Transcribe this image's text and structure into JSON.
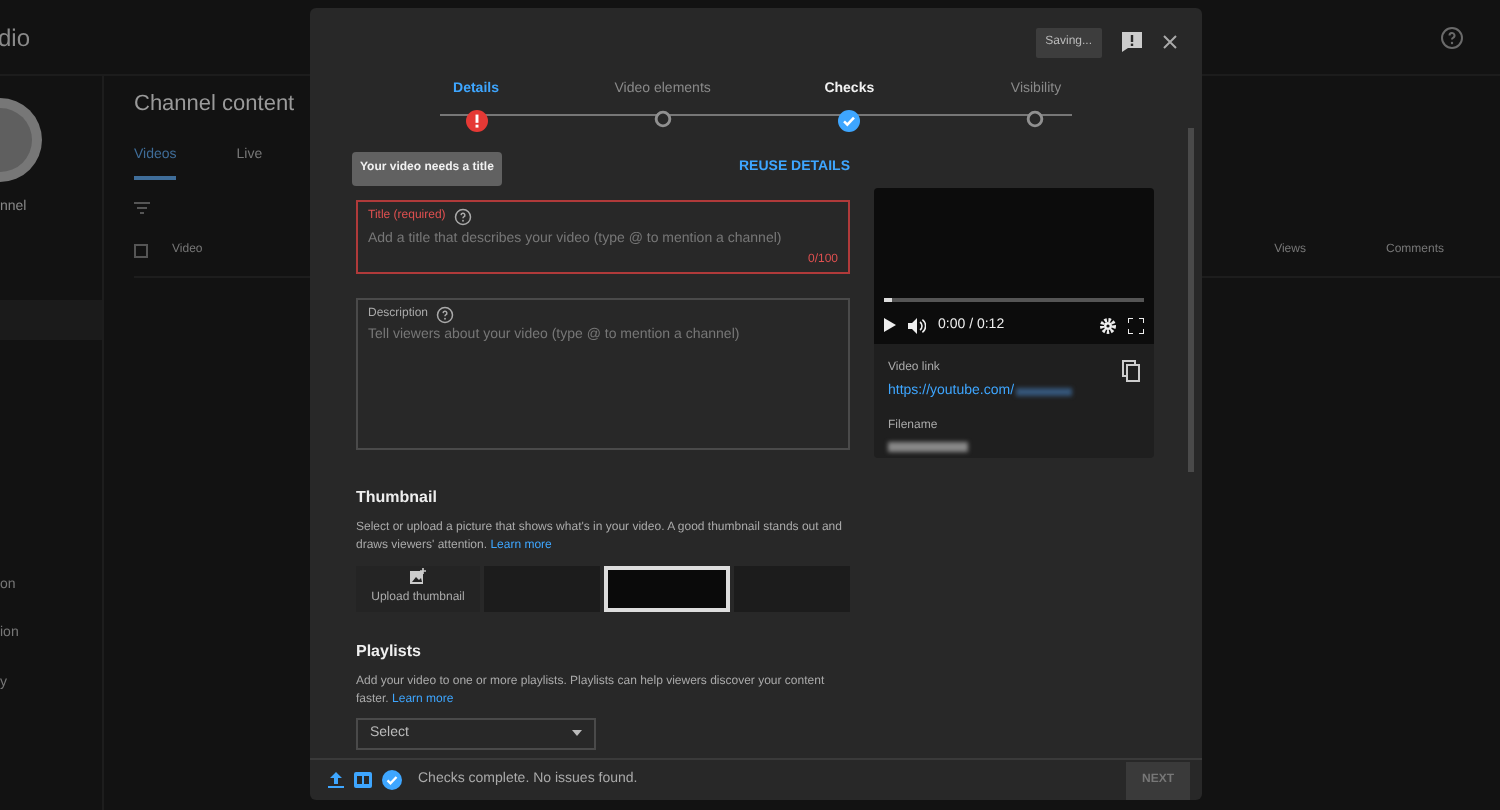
{
  "background": {
    "logo_text": "dio",
    "channel_name": "nnel",
    "sidebar_items": [
      "on",
      "ion",
      "y"
    ],
    "page_title": "Channel content",
    "tabs": [
      {
        "label": "Videos",
        "selected": true
      },
      {
        "label": "Live",
        "selected": false
      }
    ],
    "select_all": {
      "checked": false
    },
    "columns": [
      "Video",
      "Views",
      "Comments"
    ]
  },
  "dialog": {
    "saving_badge": "Saving...",
    "steps": [
      {
        "label": "Details",
        "kind": "error",
        "selected": true
      },
      {
        "label": "Video elements",
        "kind": "pending",
        "selected": false
      },
      {
        "label": "Checks",
        "kind": "done",
        "selected": false
      },
      {
        "label": "Visibility",
        "kind": "pending",
        "selected": false
      }
    ],
    "tooltip": "Your video needs a title",
    "reuse_button": "REUSE DETAILS",
    "title_field": {
      "label": "Title (required)",
      "placeholder": "Add a title that describes your video (type @ to mention a channel)",
      "counter": "0/100",
      "error": true
    },
    "description_field": {
      "label": "Description",
      "placeholder": "Tell viewers about your video (type @ to mention a channel)"
    },
    "thumbnail": {
      "heading": "Thumbnail",
      "text": "Select or upload a picture that shows what's in your video. A good thumbnail stands out and draws viewers' attention.",
      "link": "Learn more",
      "upload_label": "Upload thumbnail",
      "options": [
        {
          "selected": false
        },
        {
          "selected": true
        },
        {
          "selected": false
        }
      ]
    },
    "playlists": {
      "heading": "Playlists",
      "text": "Add your video to one or more playlists. Playlists can help viewers discover your content faster.",
      "link": "Learn more",
      "select_placeholder": "Select"
    },
    "video": {
      "time": "0:00 / 0:12",
      "level": 0.03,
      "link_label": "Video link",
      "link": "https://youtube.com/",
      "filename_label": "Filename"
    },
    "footer": {
      "status": "Checks complete. No issues found.",
      "next_button": "NEXT",
      "next_disabled": true
    }
  }
}
